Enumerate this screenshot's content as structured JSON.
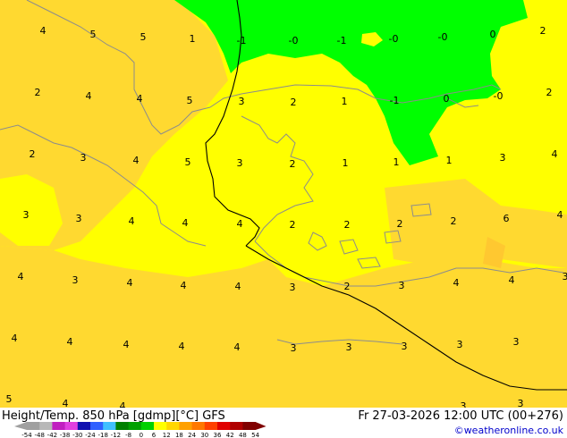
{
  "footer": {
    "title": "Height/Temp. 850 hPa [gdmp][°C] GFS",
    "datetime": "Fr 27-03-2026 12:00 UTC (00+276)",
    "copyright": "©weatheronline.co.uk"
  },
  "colorbar": {
    "ticks": [
      "-54",
      "-48",
      "-42",
      "-38",
      "-30",
      "-24",
      "-18",
      "-12",
      "-8",
      "0",
      "6",
      "12",
      "18",
      "24",
      "30",
      "36",
      "42",
      "48",
      "54"
    ],
    "colors": [
      "#a0a0a0",
      "#b8b8b8",
      "#c020c0",
      "#e040e0",
      "#1010b0",
      "#3060ff",
      "#40c0ff",
      "#008000",
      "#00a000",
      "#00d000",
      "#ffff00",
      "#ffd700",
      "#ffa000",
      "#ff7800",
      "#ff4000",
      "#e00000",
      "#b00000",
      "#800000"
    ]
  },
  "map": {
    "colors": {
      "zone_0": "#ffff00",
      "zone_2": "#ffd930",
      "zone_neg": "#00ff00",
      "border": "#000000",
      "coast": "#8c8c8c"
    },
    "temperature_labels": [
      "4",
      "5",
      "5",
      "1",
      "-1",
      "-0",
      "-1",
      "-0",
      "-0",
      "0",
      "2",
      "2",
      "4",
      "4",
      "5",
      "3",
      "2",
      "1",
      "-1",
      "0",
      "-0",
      "2",
      "2",
      "3",
      "4",
      "5",
      "3",
      "2",
      "1",
      "1",
      "1",
      "3",
      "4",
      "3",
      "3",
      "4",
      "4",
      "4",
      "2",
      "2",
      "2",
      "2",
      "6",
      "4",
      "4",
      "3",
      "4",
      "4",
      "4",
      "3",
      "2",
      "3",
      "4",
      "4",
      "3",
      "4",
      "4",
      "4",
      "4",
      "4",
      "3",
      "3",
      "3",
      "3",
      "3",
      "5",
      "4",
      "4",
      "3",
      "3"
    ]
  }
}
